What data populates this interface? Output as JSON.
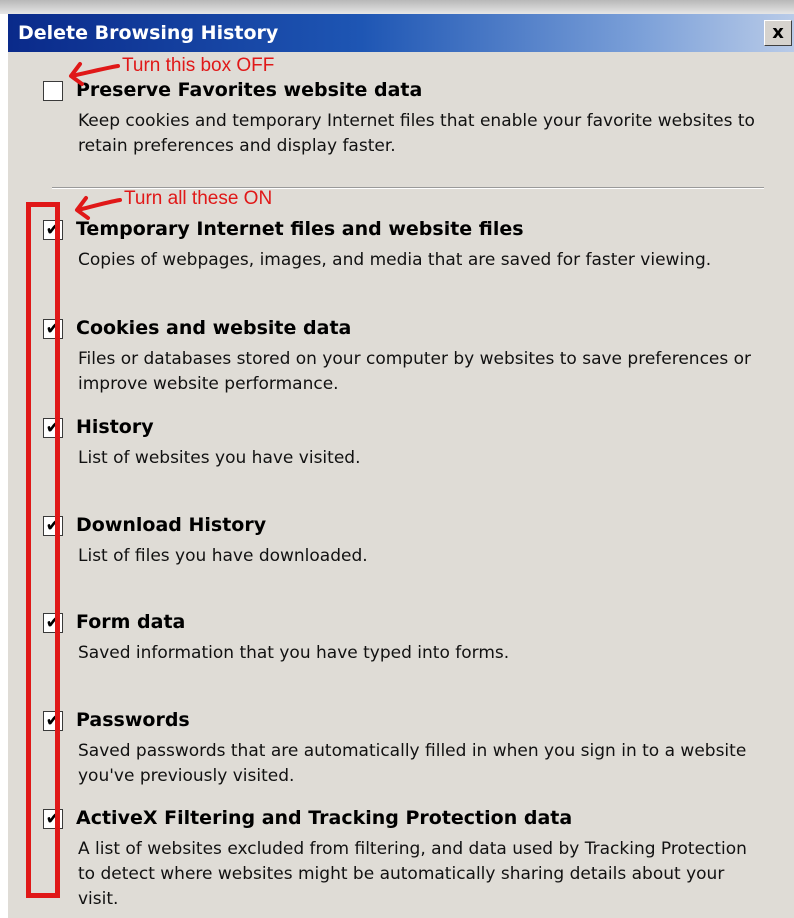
{
  "dialog": {
    "title": "Delete Browsing History",
    "close_label": "x"
  },
  "annotations": {
    "top_note": "Turn this box OFF",
    "group_note": "Turn all these ON",
    "color": "#e01818"
  },
  "options": [
    {
      "title": "Preserve Favorites website data",
      "desc": "Keep cookies and temporary Internet files that enable your favorite websites to retain preferences and display faster.",
      "checked": false
    },
    {
      "title": "Temporary Internet files and website files",
      "desc": "Copies of webpages, images, and media that are saved for faster viewing.",
      "checked": true
    },
    {
      "title": "Cookies and website data",
      "desc": "Files or databases stored on your computer by websites to save preferences or improve website performance.",
      "checked": true
    },
    {
      "title": "History",
      "desc": "List of websites you have visited.",
      "checked": true
    },
    {
      "title": "Download History",
      "desc": "List of files you have downloaded.",
      "checked": true
    },
    {
      "title": "Form data",
      "desc": "Saved information that you have typed into forms.",
      "checked": true
    },
    {
      "title": "Passwords",
      "desc": "Saved passwords that are automatically filled in when you sign in to a website you've previously visited.",
      "checked": true
    },
    {
      "title": "ActiveX Filtering and Tracking Protection data",
      "desc": "A list of websites excluded from filtering, and data used by Tracking Protection to detect where websites might be automatically sharing details about your visit.",
      "checked": true
    }
  ],
  "colors": {
    "titlebar_start": "#0a2a8a",
    "titlebar_end": "#b9cbe8",
    "dialog_bg": "#dfdcd6"
  }
}
